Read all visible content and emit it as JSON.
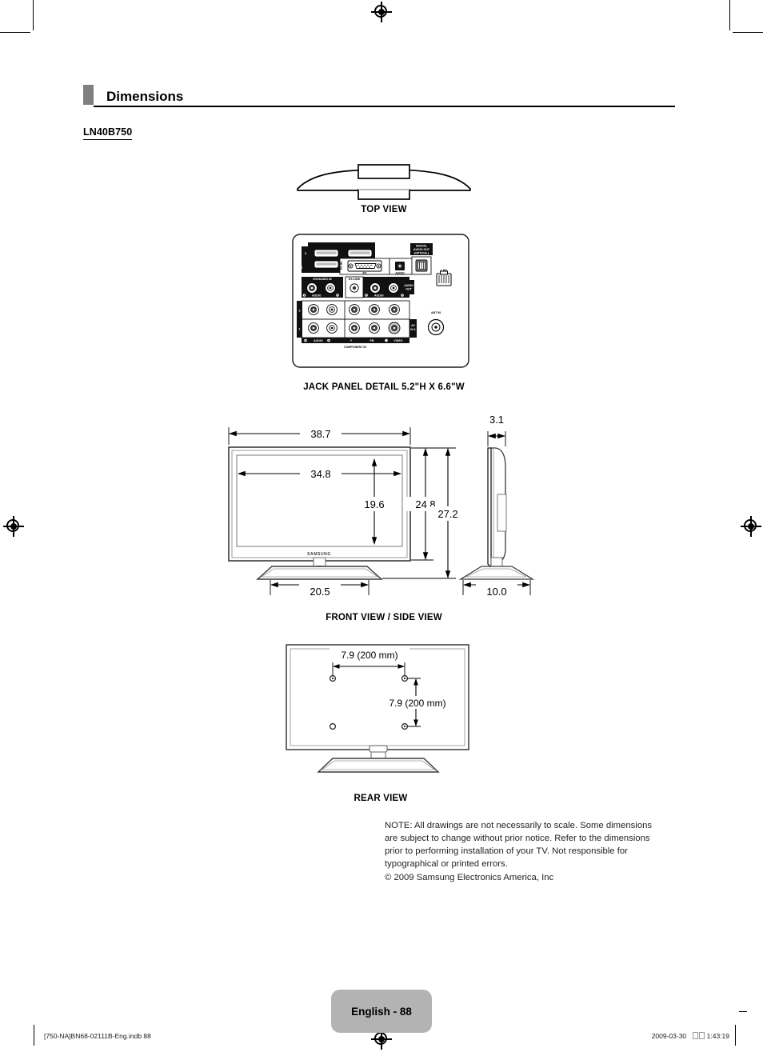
{
  "header": {
    "title": "Dimensions",
    "marker_color": "#808080"
  },
  "model": {
    "name": "LN40B750"
  },
  "figures": {
    "top_view": {
      "caption": "TOP VIEW"
    },
    "jack_panel": {
      "caption": "JACK PANEL DETAIL 5.2\"H X 6.6\"W",
      "labels": {
        "hdmi_in": "HDMI IN",
        "hdmi_2": "2",
        "hdmi_1": "1",
        "hdmi_1_dvi": "1\n(DVI)",
        "pc_in": "PC IN",
        "pc": "PC",
        "audio": "AUDIO",
        "digital_audio_out": "DIGITAL\nAUDIO OUT\n(OPTICAL)",
        "lan": "LAN",
        "dvi_audio_in": "DVI/AUDIO IN",
        "ex_link": "EX-LINK",
        "audio_lr": "AUDIO",
        "audio_out": "AUDIO\nOUT",
        "left": "L",
        "right": "R",
        "component_in": "COMPONENT IN",
        "comp_2": "2",
        "comp_1": "1",
        "av_in_1": "AV\nIN 1",
        "ant_in": "ANT IN",
        "video": "VIDEO",
        "y": "Y",
        "pb": "PB",
        "pr": "PR"
      }
    },
    "front_side_view": {
      "caption": "FRONT VIEW / SIDE VIEW",
      "brand": "SAMSUNG",
      "dimensions": {
        "outer_width": "38.7",
        "screen_width": "34.8",
        "screen_height": "19.6",
        "panel_height": "24.8",
        "total_height": "27.2",
        "stand_width": "20.5",
        "panel_depth": "3.1",
        "stand_depth": "10.0"
      }
    },
    "rear_view": {
      "caption": "REAR VIEW",
      "dimensions": {
        "horizontal_spacing": "7.9 (200 mm)",
        "vertical_spacing": "7.9 (200 mm)"
      }
    }
  },
  "note": {
    "body": "NOTE: All drawings are not necessarily to scale. Some dimensions are subject to change without prior notice. Refer to the dimensions prior to performing installation of your TV. Not responsible for typographical or printed errors.",
    "copyright": "© 2009 Samsung Electronics America, Inc"
  },
  "footer": {
    "page_label": "English - 88",
    "file_ref": "[750-NA]BN68-02111B-Eng.indb   88",
    "date": "2009-03-30",
    "time": "1:43:19"
  }
}
